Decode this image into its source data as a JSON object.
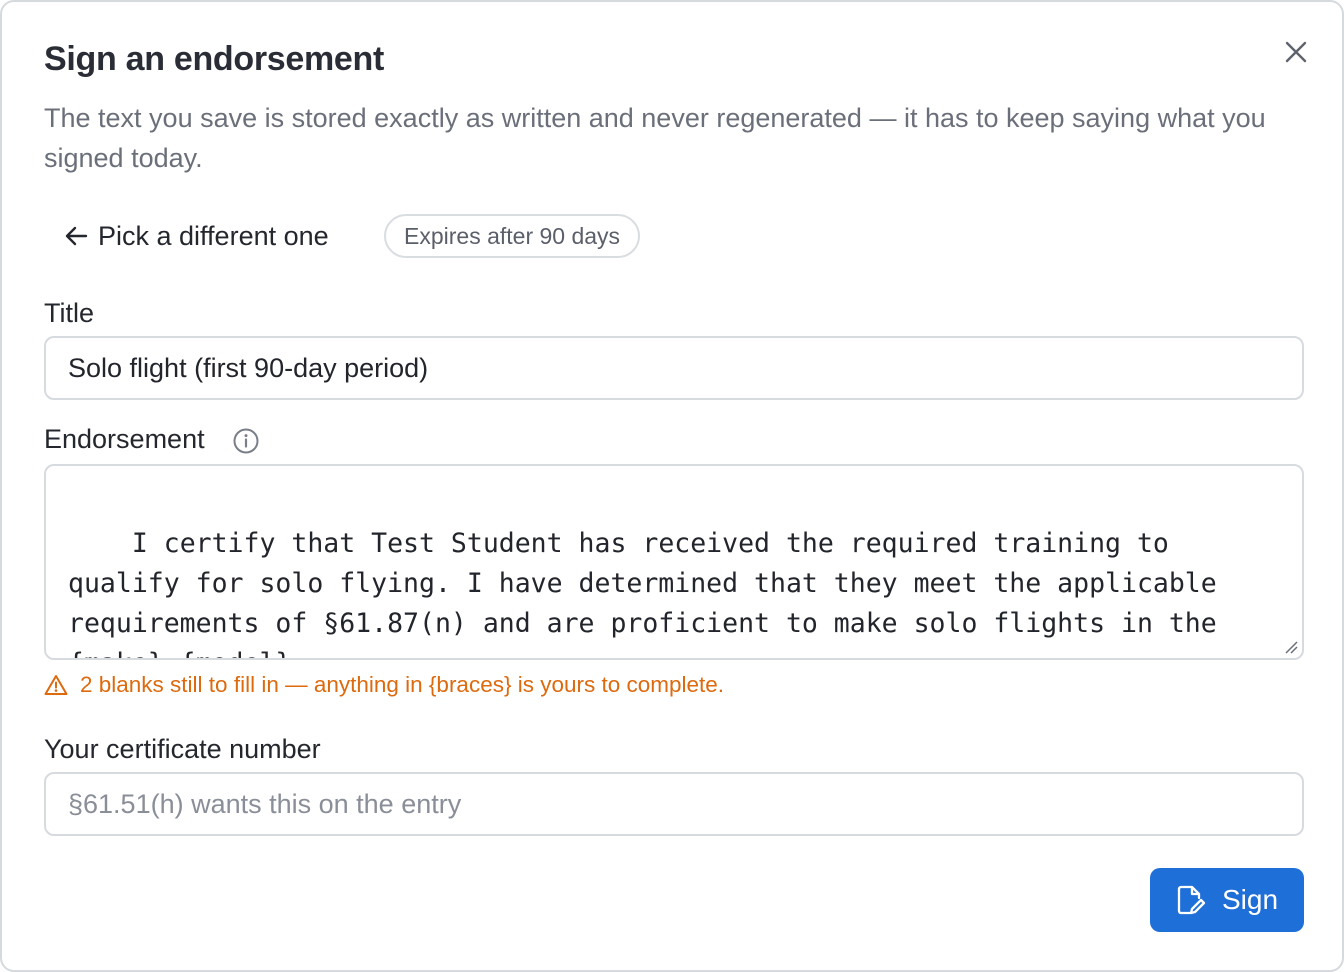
{
  "dialog": {
    "title": "Sign an endorsement",
    "subtitle": "The text you save is stored exactly as written and never regenerated — it has to keep saying what you signed today.",
    "close_icon": "close-icon"
  },
  "nav": {
    "back_label": "Pick a different one",
    "back_icon": "arrow-left-icon",
    "expiry_badge": "Expires after 90 days"
  },
  "form": {
    "title_label": "Title",
    "title_value": "Solo flight (first 90-day period)",
    "endorsement_label": "Endorsement",
    "endorsement_info_icon": "info-icon",
    "endorsement_text": "I certify that Test Student has received the required training to qualify for solo flying. I have determined that they meet the applicable requirements of §61.87(n) and are proficient to make solo flights in the {make} {model}.",
    "warning_icon": "warning-icon",
    "warning_text": "2 blanks still to fill in — anything in {braces} is yours to complete.",
    "certificate_label": "Your certificate number",
    "certificate_value": "",
    "certificate_placeholder": "§61.51(h) wants this on the entry"
  },
  "actions": {
    "sign_label": "Sign",
    "sign_icon": "sign-document-icon",
    "accent_color": "#1f6fd9",
    "warning_color": "#dd6a0e"
  }
}
